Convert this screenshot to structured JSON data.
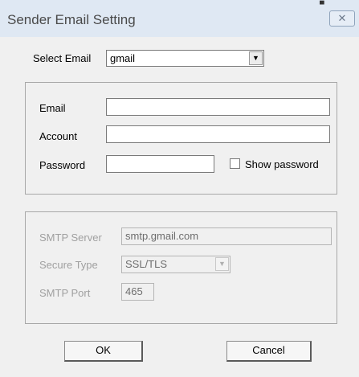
{
  "window": {
    "title": "Sender Email Setting",
    "close_glyph": "✕",
    "top_marker_glyph": "▀"
  },
  "select_email": {
    "label": "Select Email",
    "value": "gmail",
    "arrow_glyph": "▼"
  },
  "credentials": {
    "email_label": "Email",
    "email_value": "",
    "account_label": "Account",
    "account_value": "",
    "password_label": "Password",
    "password_value": "",
    "show_password_label": "Show password",
    "show_password_checked": false
  },
  "smtp": {
    "server_label": "SMTP Server",
    "server_value": "smtp.gmail.com",
    "secure_type_label": "Secure Type",
    "secure_type_value": "SSL/TLS",
    "secure_arrow_glyph": "▼",
    "port_label": "SMTP Port",
    "port_value": "465"
  },
  "buttons": {
    "ok_label": "OK",
    "cancel_label": "Cancel"
  },
  "colors": {
    "titlebar": "#dfe8f3",
    "dialog_background": "#f0f0f0",
    "disabled_text": "#a0a0a0"
  }
}
